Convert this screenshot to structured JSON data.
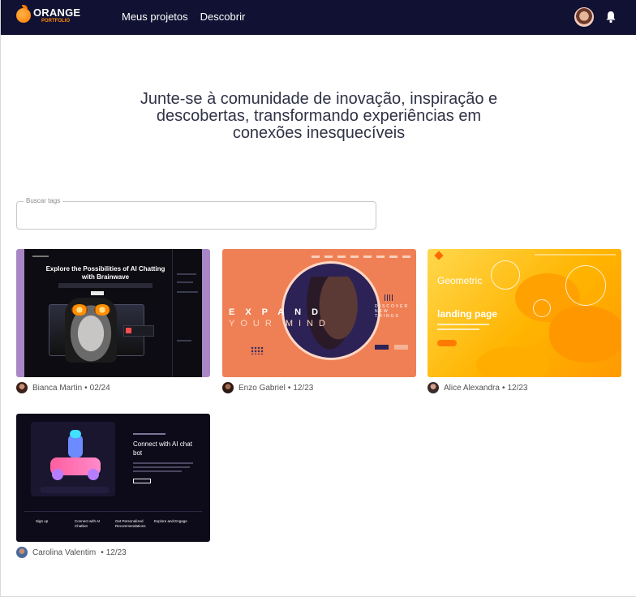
{
  "brand": {
    "name": "ORANGE",
    "sub": "PORTFOLIO"
  },
  "nav": {
    "items": [
      "Meus projetos",
      "Descobrir"
    ]
  },
  "hero": {
    "text": "Junte-se à comunidade de inovação, inspiração e descobertas, transformando experiências em conexões inesquecíveis"
  },
  "search": {
    "label": "Buscar tags",
    "value": ""
  },
  "projects": [
    {
      "author": "Bianca Martin",
      "date": "02/24",
      "thumb_title": "Explore the Possibilities of AI Chatting with Brainwave",
      "thumb_logo": "Brainwave"
    },
    {
      "author": "Enzo Gabriel",
      "date": "12/23",
      "thumb_title": "EXPAND",
      "thumb_sub": "YOUR MIND",
      "thumb_kicker": "DISCOVER NEW THINGS"
    },
    {
      "author": "Alice Alexandra",
      "date": "12/23",
      "thumb_title": "Geometric",
      "thumb_sub": "landing page"
    },
    {
      "author": "Carolina Valentim",
      "date": "12/23",
      "thumb_title": "Connect with AI chat bot",
      "thumb_footer": [
        "Sign up",
        "Connect with AI Chatbot",
        "Get Personalized Recommendations",
        "Explore and Engage"
      ]
    }
  ],
  "meta_separator": "•",
  "colors": {
    "topbar": "#111133",
    "accent": "#ff8a00",
    "text": "#303346"
  },
  "icons": {
    "bell": "bell-icon",
    "logo": "orange-logo-icon"
  }
}
